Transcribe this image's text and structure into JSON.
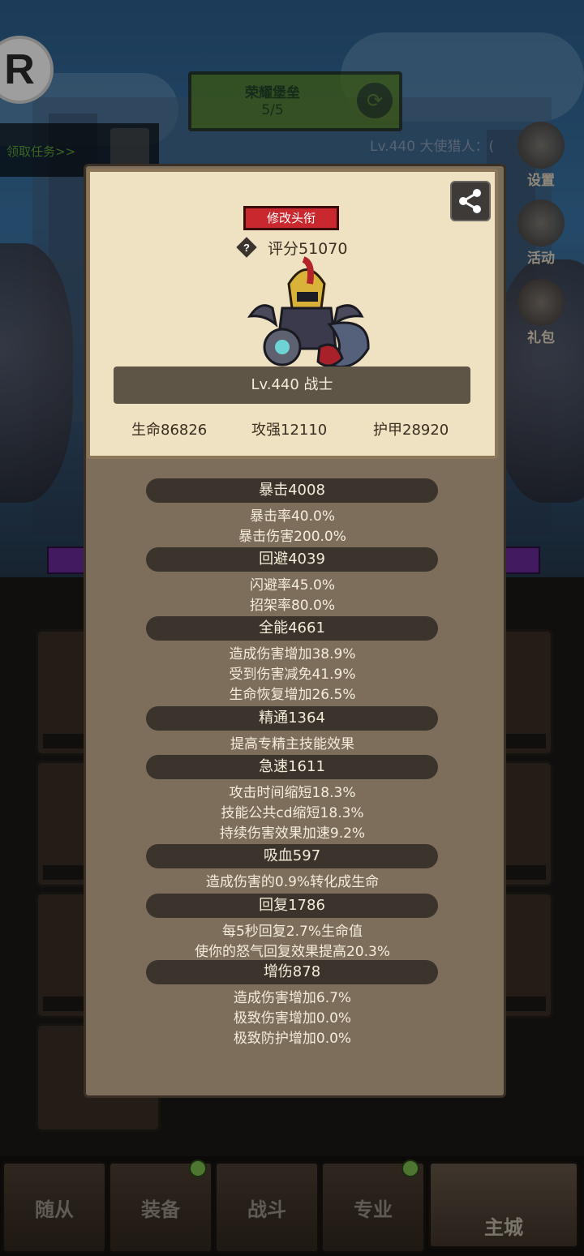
{
  "top": {
    "badge_letter": "R",
    "castle_name": "荣耀堡垒",
    "castle_progress": "5/5",
    "quest_label": "领取任务>>",
    "hunter_text": "Lv.440 大使猎人：("
  },
  "side_buttons": [
    {
      "label": "设置"
    },
    {
      "label": "活动"
    },
    {
      "label": "礼包"
    }
  ],
  "profile": {
    "rename_label": "修改头衔",
    "score": "评分51070",
    "name_line": "Lv.440 战士",
    "hp": "生命86826",
    "attack": "攻强12110",
    "armor": "护甲28920"
  },
  "stat_groups": [
    {
      "title": "暴击4008",
      "lines": [
        "暴击率40.0%",
        "暴击伤害200.0%"
      ]
    },
    {
      "title": "回避4039",
      "lines": [
        "闪避率45.0%",
        "招架率80.0%"
      ]
    },
    {
      "title": "全能4661",
      "lines": [
        "造成伤害增加38.9%",
        "受到伤害减免41.9%",
        "生命恢复增加26.5%"
      ]
    },
    {
      "title": "精通1364",
      "lines": [
        "提高专精主技能效果"
      ]
    },
    {
      "title": "急速1611",
      "lines": [
        "攻击时间缩短18.3%",
        "技能公共cd缩短18.3%",
        "持续伤害效果加速9.2%"
      ]
    },
    {
      "title": "吸血597",
      "lines": [
        "造成伤害的0.9%转化成生命"
      ]
    },
    {
      "title": "回复1786",
      "lines": [
        "每5秒回复2.7%生命值",
        "使你的怒气回复效果提高20.3%"
      ]
    },
    {
      "title": "增伤878",
      "lines": [
        "造成伤害增加6.7%",
        "极致伤害增加0.0%",
        "极致防护增加0.0%"
      ]
    }
  ],
  "nav": {
    "tabs": [
      {
        "label": "随从"
      },
      {
        "label": "装备"
      },
      {
        "label": "战斗"
      },
      {
        "label": "专业"
      },
      {
        "label": "主城"
      }
    ],
    "active_tab": "主城"
  },
  "colors": {
    "parchment": "#efe2c2",
    "panel": "#7d6e5c",
    "rename_red": "#c8282e",
    "section_dark": "#3b342d",
    "quest_green": "#5ea33a"
  }
}
